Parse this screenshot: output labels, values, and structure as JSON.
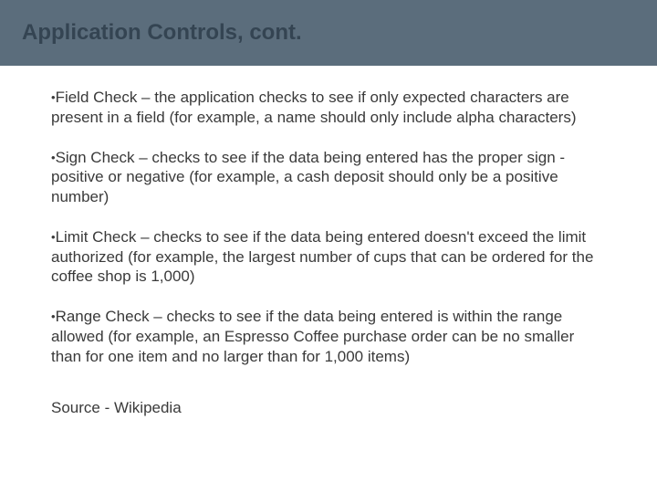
{
  "header": {
    "title": "Application Controls, cont."
  },
  "bullets": [
    {
      "text": "Field Check – the application checks to see if only expected characters are present in a field (for example, a name should only include alpha characters)"
    },
    {
      "text": "Sign Check – checks to see if the data being entered has the proper sign - positive or negative (for example, a cash deposit should only be a positive number)"
    },
    {
      "text": "Limit Check – checks to see if the data being entered doesn't exceed the limit authorized (for example, the largest number of cups that can be ordered for the coffee shop is 1,000)"
    },
    {
      "text": "Range Check – checks to see if the data being entered is within the range allowed (for example, an Espresso Coffee purchase order can be no smaller than for one item and no larger than for 1,000 items)"
    }
  ],
  "source": "Source - Wikipedia"
}
